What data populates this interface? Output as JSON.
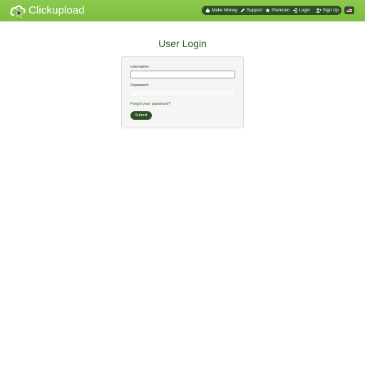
{
  "header": {
    "logo_text": "Clickupload",
    "accent_color": "#7cbe41",
    "nav_bar_color": "#2e4f22"
  },
  "nav": {
    "items": [
      {
        "label": "Make Money",
        "icon": "money-bag-icon"
      },
      {
        "label": "Support",
        "icon": "pencil-icon"
      },
      {
        "label": "Premium",
        "icon": "star-icon"
      },
      {
        "label": "Login",
        "icon": "login-icon"
      },
      {
        "label": "Sign Up",
        "icon": "user-plus-icon"
      }
    ],
    "language_icon": "flag-icon"
  },
  "main": {
    "title": "User Login",
    "form": {
      "username_label": "Username:",
      "username_value": "",
      "password_label": "Password:",
      "password_value": "",
      "forgot_link": "Forgot your password?",
      "submit_label": "Submit"
    }
  }
}
